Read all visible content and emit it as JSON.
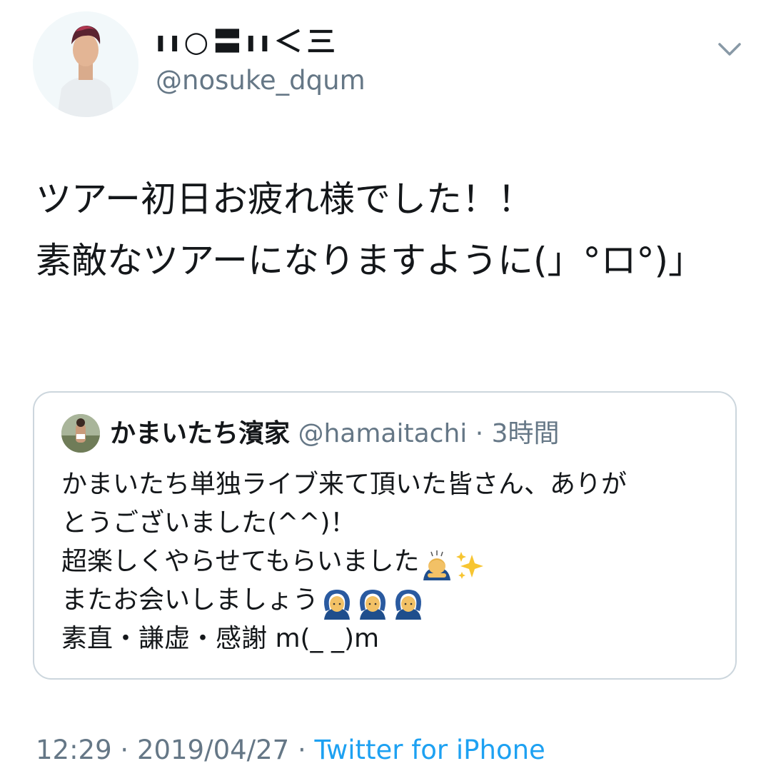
{
  "tweet": {
    "display_name": "ıı○〓ıı＜三",
    "handle": "@nosuke_dqum",
    "text": "ツアー初日お疲れ様でした！！\n素敵なツアーになりますように(」°ロ°)」",
    "time": "12:29",
    "date": "2019/04/27",
    "separator": " · ",
    "source": "Twitter for iPhone"
  },
  "quoted": {
    "name": "かまいたち濱家",
    "handle": "@hamaitachi",
    "separator": "·",
    "time": "3時間",
    "lines": [
      "かまいたち単独ライブ来て頂いた皆さん、ありが",
      "とうございました(^^)！",
      "超楽しくやらせてもらいました",
      "またお会いしましょう",
      "素直・謙虚・感謝 m(_ _)m"
    ],
    "emojis": {
      "line3": [
        "person-bowing-emoji",
        "sparkles-emoji"
      ],
      "line4": [
        "person-gesturing-ok-emoji",
        "person-gesturing-ok-emoji",
        "person-gesturing-ok-emoji"
      ]
    }
  },
  "icons": {
    "menu": "chevron-down-icon"
  },
  "colors": {
    "text": "#14171a",
    "secondary": "#657786",
    "link": "#1da1f2",
    "border": "#ccd6dd"
  }
}
